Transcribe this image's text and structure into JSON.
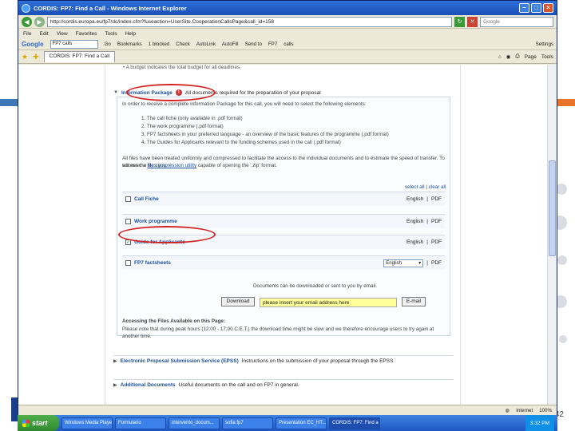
{
  "window": {
    "title": "CORDIS: FP7: Find a Call - Windows Internet Explorer",
    "address": "http://cordis.europa.eu/fp7/dc/index.cfm?fuseaction=UserSite.CooperationCallsPage&call_id=158",
    "search_placeholder": "Google"
  },
  "menu": [
    "File",
    "Edit",
    "View",
    "Favorites",
    "Tools",
    "Help"
  ],
  "google_toolbar": {
    "logo": "Google",
    "query": "FP7 calls",
    "items": [
      "Go",
      "Bookmarks",
      "1 blocked",
      "Check",
      "AutoLink",
      "AutoFill",
      "Send to",
      "FP7",
      "calls"
    ],
    "settings": "Settings"
  },
  "tab": {
    "label": "CORDIS: FP7: Find a Call",
    "tools": [
      "Page",
      "Tools"
    ]
  },
  "page": {
    "cut_text": "• A budget indicates the total budget for all deadlines",
    "info_package": {
      "title": "Information Package",
      "desc": "All documents required for the preparation of your proposal",
      "intro": "In order to receive a complete Information Package for this call, you will need to select the following elements:",
      "items": [
        "1. The call fiche (only available in .pdf format)",
        "2. The work programme (.pdf format)",
        "3. FP7 factsheets in your preferred language - an overview of the basic features of the programme (.pdf format)",
        "4. The Guides for Applicants relevant to the funding schemes used in the call (.pdf format)"
      ],
      "note1": "All files have been treated uniformly and compressed to facilitate the access to the individual documents and to estimate the speed of transfer. To access the files you",
      "note2_pre": "will need a",
      "note2_link": "file compression utility",
      "note2_post": "capable of opening the '.zip' format.",
      "select_all": "select all",
      "clear_all": "clear all",
      "docs": [
        {
          "name": "Call Fiche",
          "lang": "English",
          "fmt": "PDF",
          "checked": false
        },
        {
          "name": "Work programme",
          "lang": "English",
          "fmt": "PDF",
          "checked": false
        },
        {
          "name": "Guide for Applicants",
          "lang": "English",
          "fmt": "PDF",
          "checked": true
        },
        {
          "name": "FP7 factsheets",
          "lang": "English",
          "fmt": "PDF",
          "checked": false
        }
      ],
      "download_note": "Documents can be downloaded or sent to you by email.",
      "download_btn": "Download",
      "email_value": "please insert your email address here",
      "email_btn": "E-mail",
      "access_title": "Accessing the Files Available on this Page:",
      "access_note": "Please note that during peak hours (12:00 - 17:00 C.E.T.) the download time might be slow and we therefore encourage users to try again at another time."
    },
    "eps": {
      "title": "Electronic Proposal Submission Service (EPSS)",
      "desc": "Instructions on the submission of your proposal through the EPSS"
    },
    "additional": {
      "title": "Additional Documents",
      "desc": "Useful documents on the call and on FP7 in general."
    }
  },
  "status": {
    "zone": "Internet",
    "zoom": "100%"
  },
  "taskbar": {
    "start": "start",
    "tasks": [
      "Windows Media Player",
      "Formulario",
      "intervento_docum...",
      "sofia fp7",
      "Presentation EC_HT...",
      "CORDIS: FP7: Find a ..."
    ],
    "clock": "3:32 PM"
  },
  "slide": {
    "number": "42"
  },
  "colors": {
    "accent_blue": "#3d77b8",
    "accent_orange": "#e8732a",
    "highlight": "#d52222"
  }
}
